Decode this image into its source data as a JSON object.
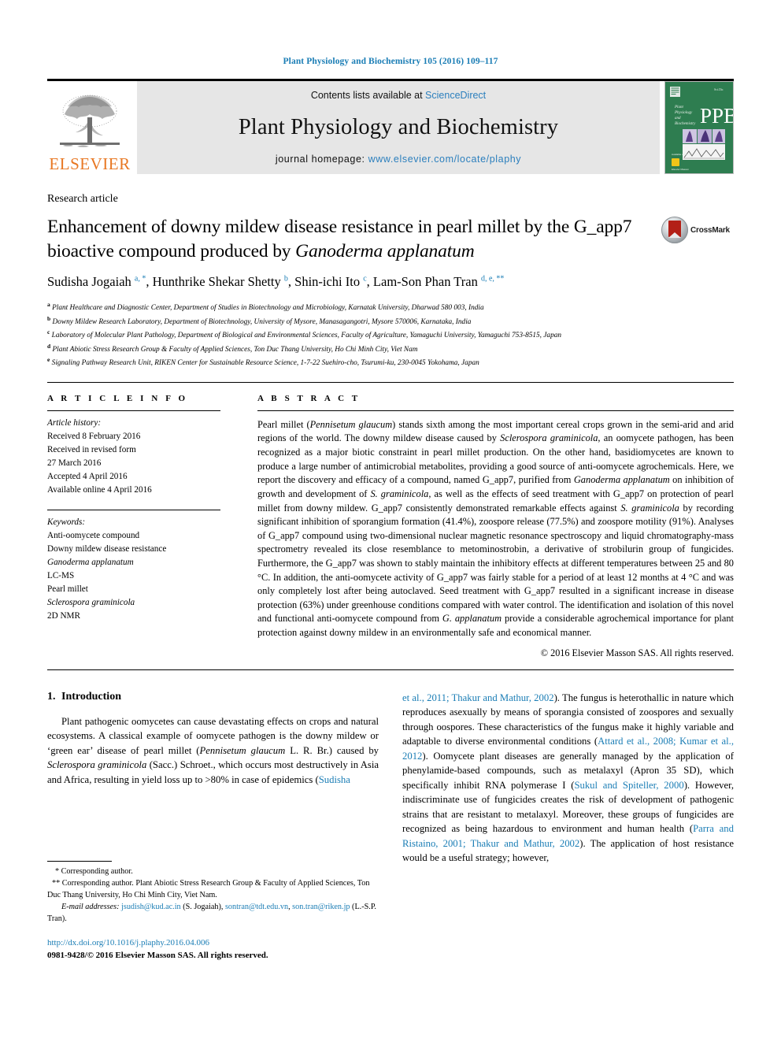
{
  "running_head": "Plant Physiology and Biochemistry 105 (2016) 109–117",
  "masthead": {
    "publisher_name": "ELSEVIER",
    "contents_prefix": "Contents lists available at ",
    "contents_link": "ScienceDirect",
    "journal_name": "Plant Physiology and Biochemistry",
    "homepage_prefix": "journal homepage: ",
    "homepage_url": "www.elsevier.com/locate/plaphy",
    "cover_title": "PPB",
    "cover_subtitle": "Plant Physiology and Biochemistry"
  },
  "article": {
    "type": "Research article",
    "title_line1": "Enhancement of downy mildew disease resistance in pearl millet by",
    "title_line2_pre": "the G_app7 bioactive compound produced by ",
    "title_line2_italic": "Ganoderma applanatum",
    "crossmark_label": "CrossMark",
    "authors_html": "Sudisha Jogaiah <sup>a, *</sup>, Hunthrike Shekar Shetty <sup>b</sup>, Shin-ichi Ito <sup>c</sup>, Lam-Son Phan Tran <sup>d, e, **</sup>",
    "affiliations": [
      {
        "marker": "a",
        "text": "Plant Healthcare and Diagnostic Center, Department of Studies in Biotechnology and Microbiology, Karnatak University, Dharwad 580 003, India"
      },
      {
        "marker": "b",
        "text": "Downy Mildew Research Laboratory, Department of Biotechnology, University of Mysore, Manasagangotri, Mysore 570006, Karnataka, India"
      },
      {
        "marker": "c",
        "text": "Laboratory of Molecular Plant Pathology, Department of Biological and Environmental Sciences, Faculty of Agriculture, Yamaguchi University, Yamaguchi 753-8515, Japan"
      },
      {
        "marker": "d",
        "text": "Plant Abiotic Stress Research Group & Faculty of Applied Sciences, Ton Duc Thang University, Ho Chi Minh City, Viet Nam"
      },
      {
        "marker": "e",
        "text": "Signaling Pathway Research Unit, RIKEN Center for Sustainable Resource Science, 1-7-22 Suehiro-cho, Tsurumi-ku, 230-0045 Yokohama, Japan"
      }
    ]
  },
  "article_info": {
    "heading": "A R T I C L E  I N F O",
    "history_label": "Article history:",
    "history": [
      "Received 8 February 2016",
      "Received in revised form",
      "27 March 2016",
      "Accepted 4 April 2016",
      "Available online 4 April 2016"
    ],
    "keywords_label": "Keywords:",
    "keywords": [
      "Anti-oomycete compound",
      "Downy mildew disease resistance",
      "Ganoderma applanatum",
      "LC-MS",
      "Pearl millet",
      "Sclerospora graminicola",
      "2D NMR"
    ],
    "keywords_italic_flags": [
      false,
      false,
      true,
      false,
      false,
      true,
      false
    ]
  },
  "abstract": {
    "heading": "A B S T R A C T",
    "body_html": "Pearl millet (<i>Pennisetum glaucum</i>) stands sixth among the most important cereal crops grown in the semi-arid and arid regions of the world. The downy mildew disease caused by <i>Sclerospora graminicola</i>, an oomycete pathogen, has been recognized as a major biotic constraint in pearl millet production. On the other hand, basidiomycetes are known to produce a large number of antimicrobial metabolites, providing a good source of anti-oomycete agrochemicals. Here, we report the discovery and efficacy of a compound, named G_app7, purified from <i>Ganoderma applanatum</i> on inhibition of growth and development of <i>S. graminicola</i>, as well as the effects of seed treatment with G_app7 on protection of pearl millet from downy mildew. G_app7 consistently demonstrated remarkable effects against <i>S. graminicola</i> by recording significant inhibition of sporangium formation (41.4%), zoospore release (77.5%) and zoospore motility (91%). Analyses of G_app7 compound using two-dimensional nuclear magnetic resonance spectroscopy and liquid chromatography-mass spectrometry revealed its close resemblance to metominostrobin, a derivative of strobilurin group of fungicides. Furthermore, the G_app7 was shown to stably maintain the inhibitory effects at different temperatures between 25 and 80 &deg;C. In addition, the anti-oomycete activity of G_app7 was fairly stable for a period of at least 12 months at 4 &deg;C and was only completely lost after being autoclaved. Seed treatment with G_app7 resulted in a significant increase in disease protection (63%) under greenhouse conditions compared with water control. The identification and isolation of this novel and functional anti-oomycete compound from <i>G. applanatum</i> provide a considerable agrochemical importance for plant protection against downy mildew in an environmentally safe and economical manner.",
    "copyright": "© 2016 Elsevier Masson SAS. All rights reserved."
  },
  "introduction": {
    "number": "1.",
    "title": "Introduction",
    "col_left_html": "Plant pathogenic oomycetes can cause devastating effects on crops and natural ecosystems. A classical example of oomycete pathogen is the downy mildew or &lsquo;green ear&rsquo; disease of pearl millet (<i>Pennisetum glaucum</i> L. R. Br.) caused by <i>Sclerospora graminicola</i> (Sacc.) Schroet., which occurs most destructively in Asia and Africa, resulting in yield loss up to &gt;80% in case of epidemics (<span class=\"cite\">Sudisha</span>",
    "col_right_html": "<span class=\"cite\">et al., 2011; Thakur and Mathur, 2002</span>). The fungus is heterothallic in nature which reproduces asexually by means of sporangia consisted of zoospores and sexually through oospores. These characteristics of the fungus make it highly variable and adaptable to diverse environmental conditions (<span class=\"cite\">Attard et al., 2008; Kumar et al., 2012</span>). Oomycete plant diseases are generally managed by the application of phenylamide-based compounds, such as metalaxyl (Apron 35 SD), which specifically inhibit RNA polymerase I (<span class=\"cite\">Sukul and Spiteller, 2000</span>). However, indiscriminate use of fungicides creates the risk of development of pathogenic strains that are resistant to metalaxyl. Moreover, these groups of fungicides are recognized as being hazardous to environment and human health (<span class=\"cite\">Parra and Ristaino, 2001; Thakur and Mathur, 2002</span>). The application of host resistance would be a useful strategy; however,"
  },
  "footnotes": {
    "corresponding_1": "* Corresponding author.",
    "corresponding_2": "** Corresponding author. Plant Abiotic Stress Research Group & Faculty of Applied Sciences, Ton Duc Thang University, Ho Chi Minh City, Viet Nam.",
    "email_label": "E-mail addresses:",
    "email_1": "jsudish@kud.ac.in",
    "email_1_owner": "(S. Jogaiah),",
    "email_2": "sontran@tdt.edu.vn",
    "email_3": "son.tran@riken.jp",
    "email_3_owner": "(L.-S.P. Tran).",
    "doi": "http://dx.doi.org/10.1016/j.plaphy.2016.04.006",
    "issn_line": "0981-9428/© 2016 Elsevier Masson SAS. All rights reserved."
  },
  "colors": {
    "link_blue": "#1a7db5",
    "sciencedirect_blue": "#2b7fbd",
    "elsevier_orange": "#e87722",
    "cover_green": "#2e7d50",
    "crossmark_red": "#b32017",
    "band_gray": "#e6e6e6"
  }
}
